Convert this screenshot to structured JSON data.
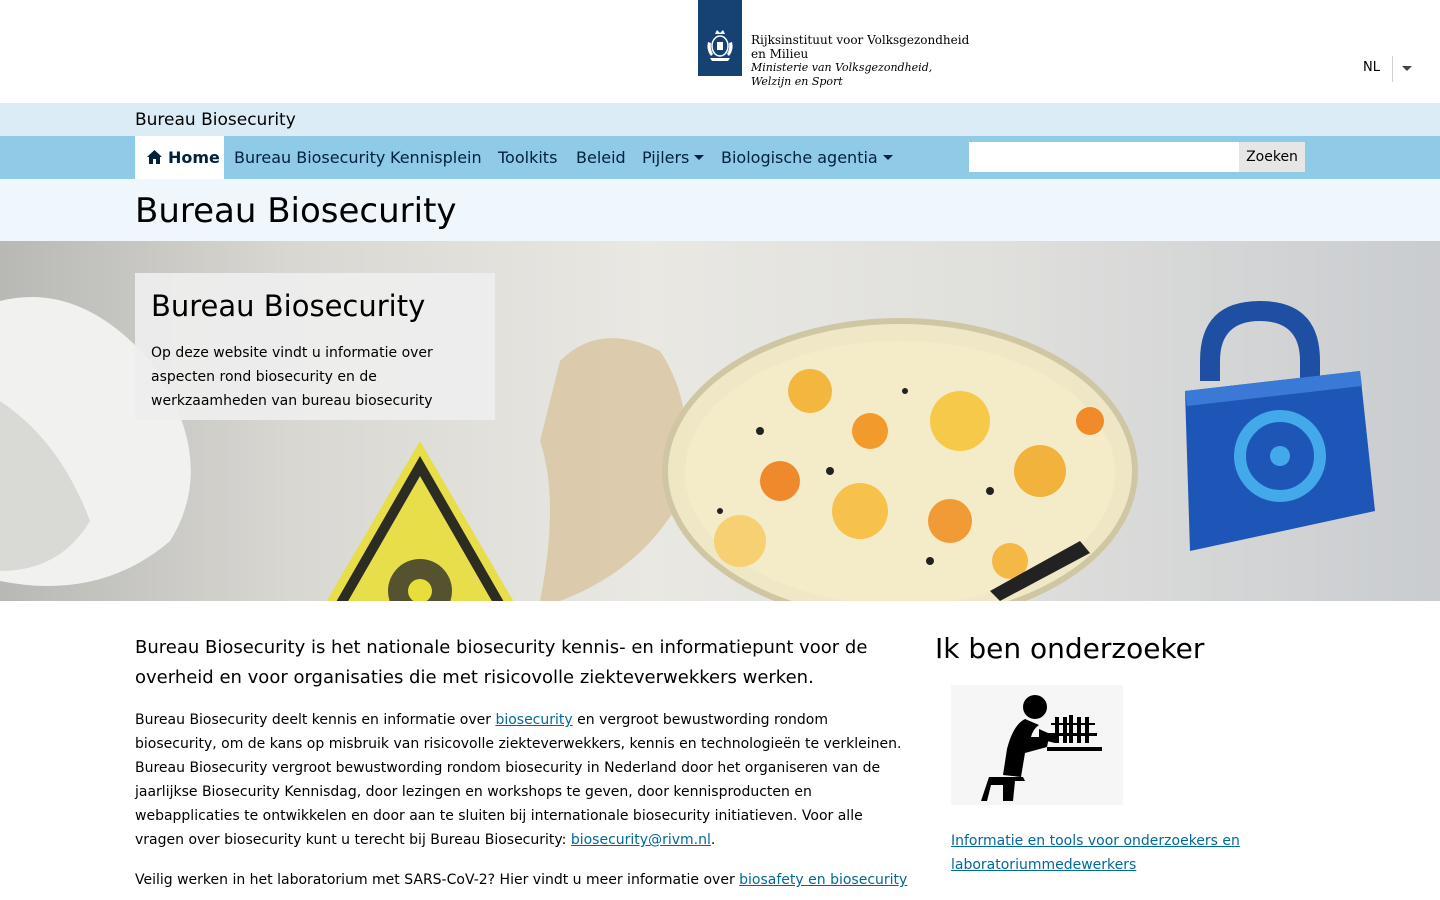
{
  "header": {
    "org_name_line1": "Rijksinstituut voor Volksgezondheid",
    "org_name_line2": "en Milieu",
    "ministry_line1": "Ministerie van Volksgezondheid,",
    "ministry_line2": "Welzijn en Sport",
    "language": "NL",
    "logo_icon": "royal-emblem-icon"
  },
  "site": {
    "title": "Bureau Biosecurity"
  },
  "nav": {
    "items": [
      {
        "label": "Home",
        "icon": "home-icon"
      },
      {
        "label": "Bureau Biosecurity"
      },
      {
        "label": "Kennisplein"
      },
      {
        "label": "Toolkits"
      },
      {
        "label": "Beleid"
      },
      {
        "label": "Pijlers",
        "has_dropdown": true
      },
      {
        "label": "Biologische agentia",
        "has_dropdown": true
      }
    ],
    "search_placeholder": "",
    "search_button": "Zoeken"
  },
  "page": {
    "title": "Bureau Biosecurity"
  },
  "hero": {
    "title": "Bureau Biosecurity",
    "text": "Op deze website vindt u informatie over aspecten rond biosecurity en de werkzaamheden van bureau biosecurity"
  },
  "main": {
    "intro": "Bureau Biosecurity is het nationale biosecurity kennis- en informatiepunt voor de overheid en voor organisaties die met risicovolle ziekteverwekkers werken.",
    "para1_before_link": "Bureau Biosecurity deelt kennis en informatie over ",
    "para1_link": "biosecurity",
    "para1_middle": " en vergroot bewustwording rondom biosecurity, om de kans op misbruik van risicovolle ziekteverwekkers, kennis en technologieën te verkleinen. Bureau Biosecurity vergroot bewustwording rondom biosecurity in Nederland door het organiseren van de jaarlijkse Biosecurity Kennisdag, door lezingen en workshops te geven, door kennisproducten en webapplicaties te ontwikkelen en door aan te sluiten bij internationale biosecurity initiatieven. Voor alle vragen over biosecurity kunt u terecht bij Bureau Biosecurity: ",
    "para1_email": "biosecurity@rivm.nl",
    "para1_end": ".",
    "para2_before_link": "Veilig werken in het laboratorium met SARS-CoV-2? Hier vindt u meer informatie over  ",
    "para2_link": "biosafety en biosecurity"
  },
  "sidebar": {
    "title": "Ik ben onderzoeker",
    "image_icon": "researcher-lab-icon",
    "link": "Informatie en tools voor onderzoekers en laboratoriummedewerkers"
  },
  "colors": {
    "rijks_blue": "#154273",
    "nav_bg": "#8fcae7",
    "strip_bg": "#dcecf6",
    "title_band_bg": "#eff7fc",
    "link": "#01689b"
  }
}
